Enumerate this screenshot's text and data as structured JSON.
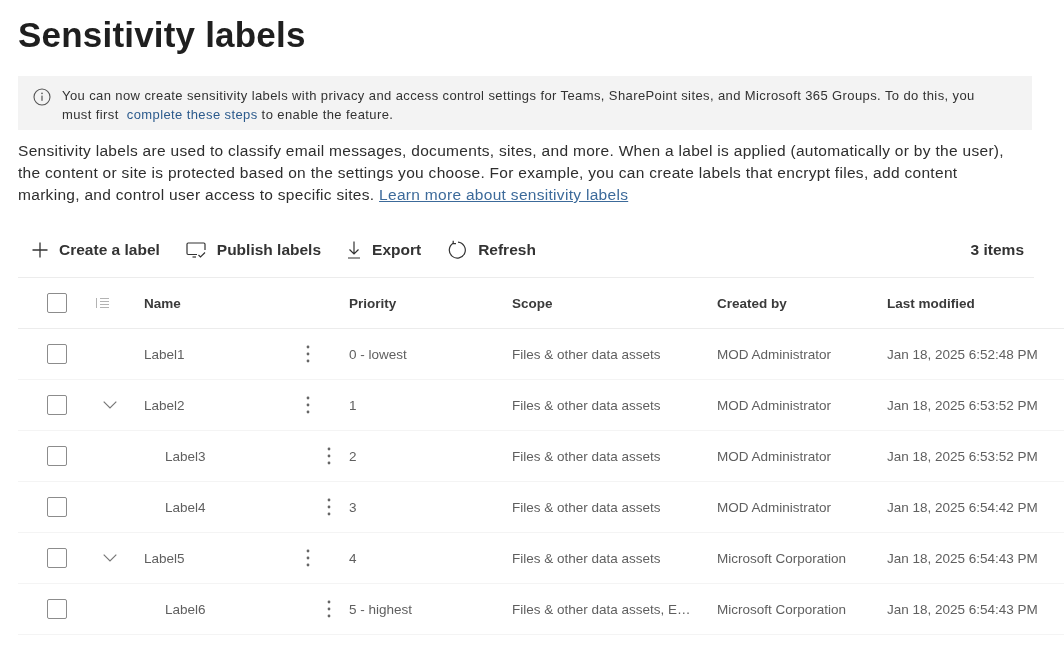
{
  "page_title": "Sensitivity labels",
  "info_banner": {
    "text_before": "You can now create sensitivity labels with privacy and access control settings for Teams, SharePoint sites, and Microsoft 365 Groups. To do this, you must first",
    "link": "complete these steps",
    "text_after": "to enable the feature."
  },
  "description": {
    "text": "Sensitivity labels are used to classify email messages, documents, sites, and more. When a label is applied (automatically or by the user), the content or site is protected based on the settings you choose. For example, you can create labels that encrypt files, add content marking, and control user access to specific sites.",
    "link": "Learn more about sensitivity labels"
  },
  "toolbar": {
    "actions": [
      {
        "kind": "add",
        "label": "Create a label"
      },
      {
        "kind": "publish",
        "label": "Publish labels"
      },
      {
        "kind": "export",
        "label": "Export"
      },
      {
        "kind": "refresh",
        "label": "Refresh"
      }
    ],
    "item_count": "3 items"
  },
  "table": {
    "select_all": {
      "checked": false
    },
    "columns": [
      "Name",
      "Priority",
      "Scope",
      "Created by",
      "Last modified"
    ],
    "rows": [
      {
        "name": "Label1",
        "priority": "0 - lowest",
        "scope": "Files & other data assets",
        "created_by": "MOD Administrator",
        "last_modified": "Jan 18, 2025 6:52:48 PM",
        "checked": false
      },
      {
        "name": "Label2",
        "priority": "1",
        "scope": "Files & other data assets",
        "created_by": "MOD Administrator",
        "last_modified": "Jan 18, 2025 6:53:52 PM",
        "checked": false,
        "expanded": true,
        "children": [
          {
            "name": "Label3",
            "priority": "2",
            "scope": "Files & other data assets",
            "created_by": "MOD Administrator",
            "last_modified": "Jan 18, 2025 6:53:52 PM",
            "checked": false
          },
          {
            "name": "Label4",
            "priority": "3",
            "scope": "Files & other data assets",
            "created_by": "MOD Administrator",
            "last_modified": "Jan 18, 2025 6:54:42 PM",
            "checked": false
          }
        ]
      },
      {
        "name": "Label5",
        "priority": "4",
        "scope": "Files & other data assets",
        "created_by": "Microsoft Corporation",
        "last_modified": "Jan 18, 2025 6:54:43 PM",
        "checked": false,
        "expanded": true,
        "children": [
          {
            "name": "Label6",
            "priority": "5 - highest",
            "scope": "Files & other data assets, E…",
            "created_by": "Microsoft Corporation",
            "last_modified": "Jan 18, 2025 6:54:43 PM",
            "checked": false
          }
        ]
      }
    ]
  }
}
